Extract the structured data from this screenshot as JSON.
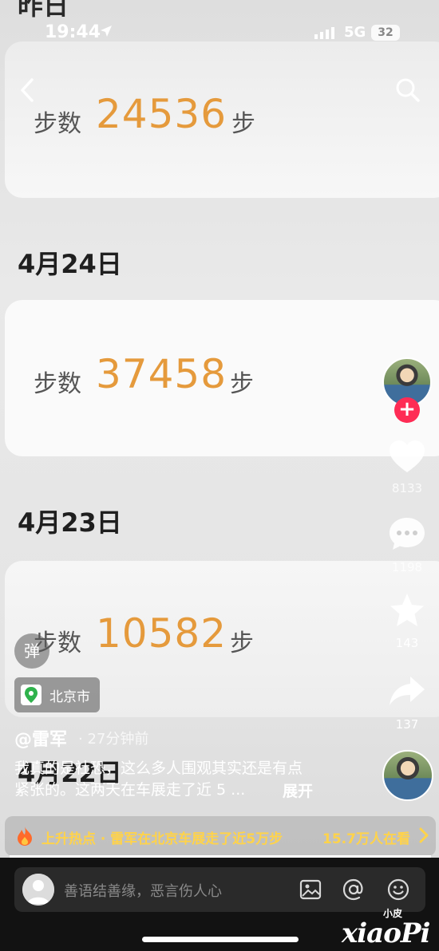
{
  "status_bar": {
    "time": "19:44",
    "network": "5G",
    "battery": "32"
  },
  "feed": {
    "prev_date": "昨日",
    "cards": [
      {
        "label": "步数",
        "value": "24536",
        "unit": "步"
      },
      {
        "label": "步数",
        "value": "37458",
        "unit": "步"
      },
      {
        "label": "步数",
        "value": "10582",
        "unit": "步"
      }
    ],
    "dates": [
      "4月24日",
      "4月23日",
      "4月22日"
    ]
  },
  "rail": {
    "like_count": "8133",
    "comment_count": "1198",
    "favorite_count": "143",
    "share_count": "137",
    "follow_symbol": "+"
  },
  "overlay": {
    "danmu_label": "弹",
    "location": "北京市",
    "author": "@雷军",
    "post_time": "· 27分钟前",
    "caption_line1": "我真的是社恐，这么多人围观其实还是有点",
    "caption_line2": "紧张的。这两天在车展走了近 5 ...",
    "expand_label": "展开"
  },
  "hot_bar": {
    "text": "上升热点 · 雷军在北京车展走了近5万步",
    "viewers": "15.7万人在看",
    "progress": 1.0
  },
  "comment_bar": {
    "placeholder": "善语结善缘，恶言伤人心"
  },
  "watermark": {
    "small": "小皮",
    "text": "xiaoPi"
  },
  "colors": {
    "accent_orange": "#e59a3c",
    "hot_yellow": "#ffd34a",
    "follow_red": "#fe2c55"
  }
}
